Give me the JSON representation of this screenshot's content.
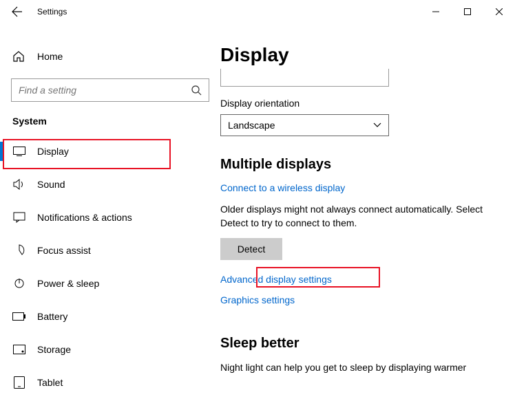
{
  "window": {
    "title": "Settings"
  },
  "sidebar": {
    "home": "Home",
    "search_placeholder": "Find a setting",
    "category": "System",
    "items": [
      {
        "label": "Display"
      },
      {
        "label": "Sound"
      },
      {
        "label": "Notifications & actions"
      },
      {
        "label": "Focus assist"
      },
      {
        "label": "Power & sleep"
      },
      {
        "label": "Battery"
      },
      {
        "label": "Storage"
      },
      {
        "label": "Tablet"
      }
    ]
  },
  "main": {
    "page_title": "Display",
    "orientation_label": "Display orientation",
    "orientation_value": "Landscape",
    "multiple_title": "Multiple displays",
    "wireless_link": "Connect to a wireless display",
    "detect_text": "Older displays might not always connect automatically. Select Detect to try to connect to them.",
    "detect_button": "Detect",
    "advanced_link": "Advanced display settings",
    "graphics_link": "Graphics settings",
    "sleep_title": "Sleep better",
    "sleep_text": "Night light can help you get to sleep by displaying warmer"
  }
}
